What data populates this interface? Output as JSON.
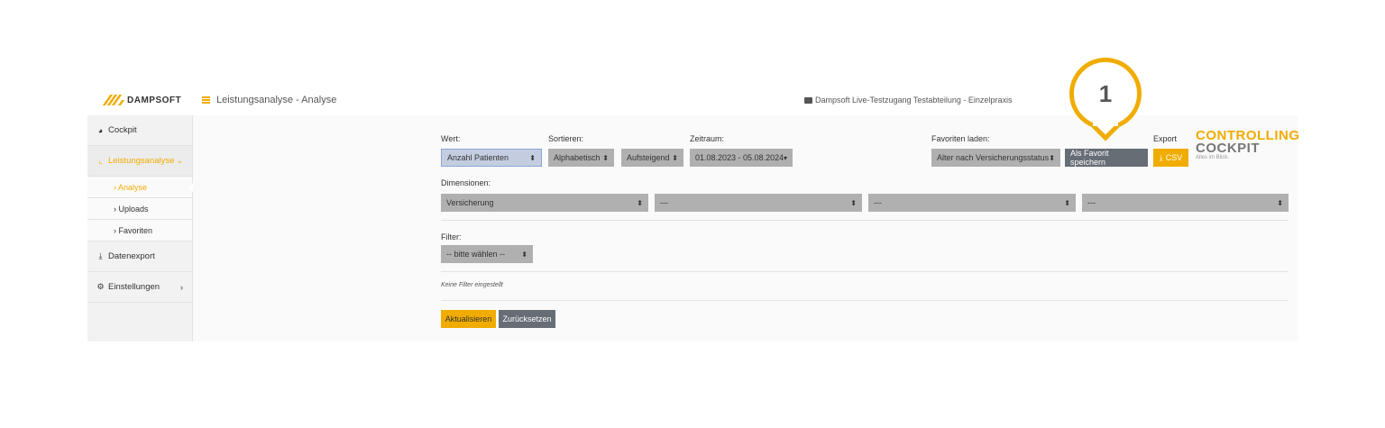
{
  "header": {
    "brand": "DAMPSOFT",
    "title": "Leistungsanalyse - Analyse",
    "account": "Dampsoft Live-Testzugang Testabteilung - Einzelpraxis"
  },
  "sidebar": {
    "items": [
      {
        "label": "Cockpit",
        "icon": "dashboard-icon"
      },
      {
        "label": "Leistungsanalyse",
        "icon": "chart-icon"
      },
      {
        "label": "Datenexport",
        "icon": "download-icon"
      },
      {
        "label": "Einstellungen",
        "icon": "gears-icon"
      }
    ],
    "subitems": [
      {
        "label": "› Analyse"
      },
      {
        "label": "› Uploads"
      },
      {
        "label": "› Favoriten"
      }
    ]
  },
  "form": {
    "wert_label": "Wert:",
    "wert_value": "Anzahl Patienten",
    "sortieren_label": "Sortieren:",
    "sort_field": "Alphabetisch",
    "sort_dir": "Aufsteigend",
    "zeitraum_label": "Zeitraum:",
    "zeitraum_value": "01.08.2023 - 05.08.2024",
    "favoriten_label": "Favoriten laden:",
    "favoriten_value": "Alter nach Versicherungsstatus",
    "save_favorite": "Als Favorit speichern",
    "export_label": "Export",
    "csv_label": "CSV",
    "dimensionen_label": "Dimensionen:",
    "dimensions": [
      "Versicherung",
      "---",
      "---",
      "---"
    ],
    "filter_label": "Filter:",
    "filter_value": "-- bitte wählen --",
    "no_filter": "Keine Filter eingestellt",
    "update_button": "Aktualisieren",
    "reset_button": "Zurücksetzen"
  },
  "brand_logo": {
    "line1": "CONTROLLING",
    "line2": "COCKPIT",
    "tagline": "Alles im Blick."
  },
  "callout": {
    "number": "1"
  },
  "colors": {
    "accent": "#f0ac00",
    "dark_button": "#666d75",
    "select_bg": "#b0b0b0"
  }
}
